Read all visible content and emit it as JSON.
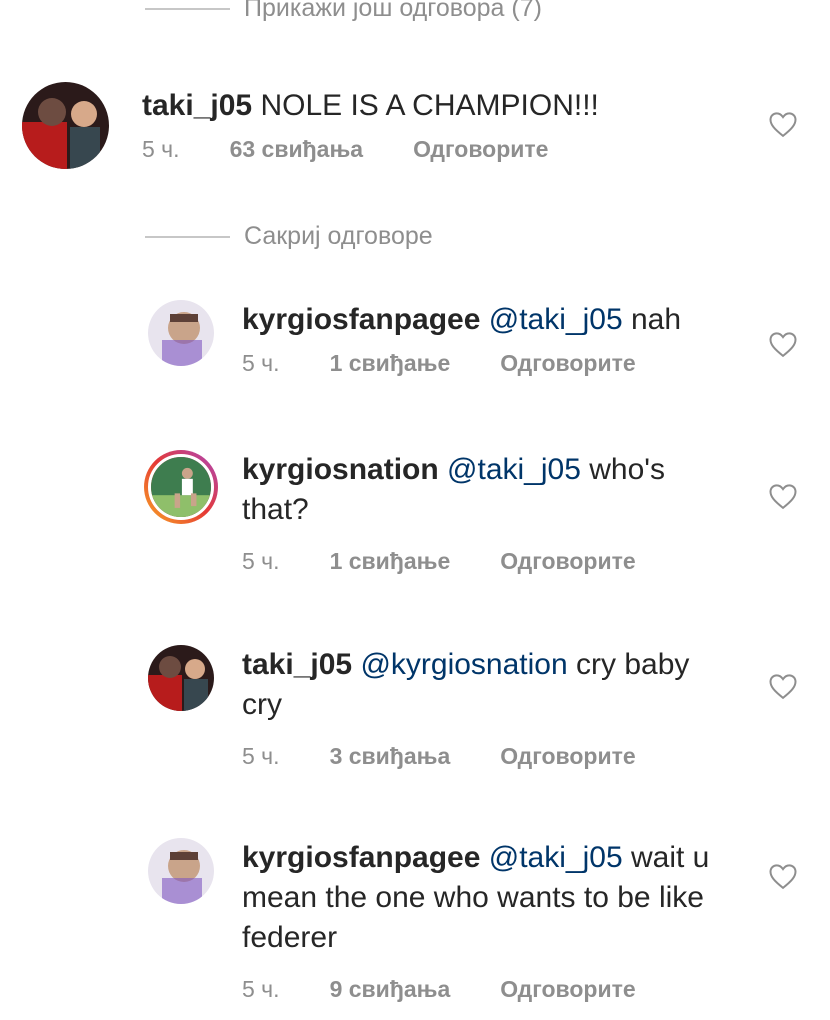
{
  "show_more_replies": "Прикажи још одговора (7)",
  "hide_replies": "Сакриј одговоре",
  "comments": [
    {
      "username": "taki_j05",
      "mention": "",
      "text": "NOLE IS A CHAMPION!!!",
      "time": "5 ч.",
      "likes": "63 свиђања",
      "reply": "Одговорите"
    },
    {
      "username": "kyrgiosfanpagee",
      "mention": "@taki_j05",
      "text": "nah",
      "time": "5 ч.",
      "likes": "1 свиђање",
      "reply": "Одговорите"
    },
    {
      "username": "kyrgiosnation",
      "mention": "@taki_j05",
      "text": "who's that?",
      "time": "5 ч.",
      "likes": "1 свиђање",
      "reply": "Одговорите"
    },
    {
      "username": "taki_j05",
      "mention": "@kyrgiosnation",
      "text": "cry baby cry",
      "time": "5 ч.",
      "likes": "3 свиђања",
      "reply": "Одговорите"
    },
    {
      "username": "kyrgiosfanpagee",
      "mention": "@taki_j05",
      "text": "wait u mean the one who wants to be like federer",
      "time": "5 ч.",
      "likes": "9 свиђања",
      "reply": "Одговорите"
    }
  ],
  "icons": {
    "heart": "heart-outline-icon",
    "avatar": "profile-photo"
  }
}
